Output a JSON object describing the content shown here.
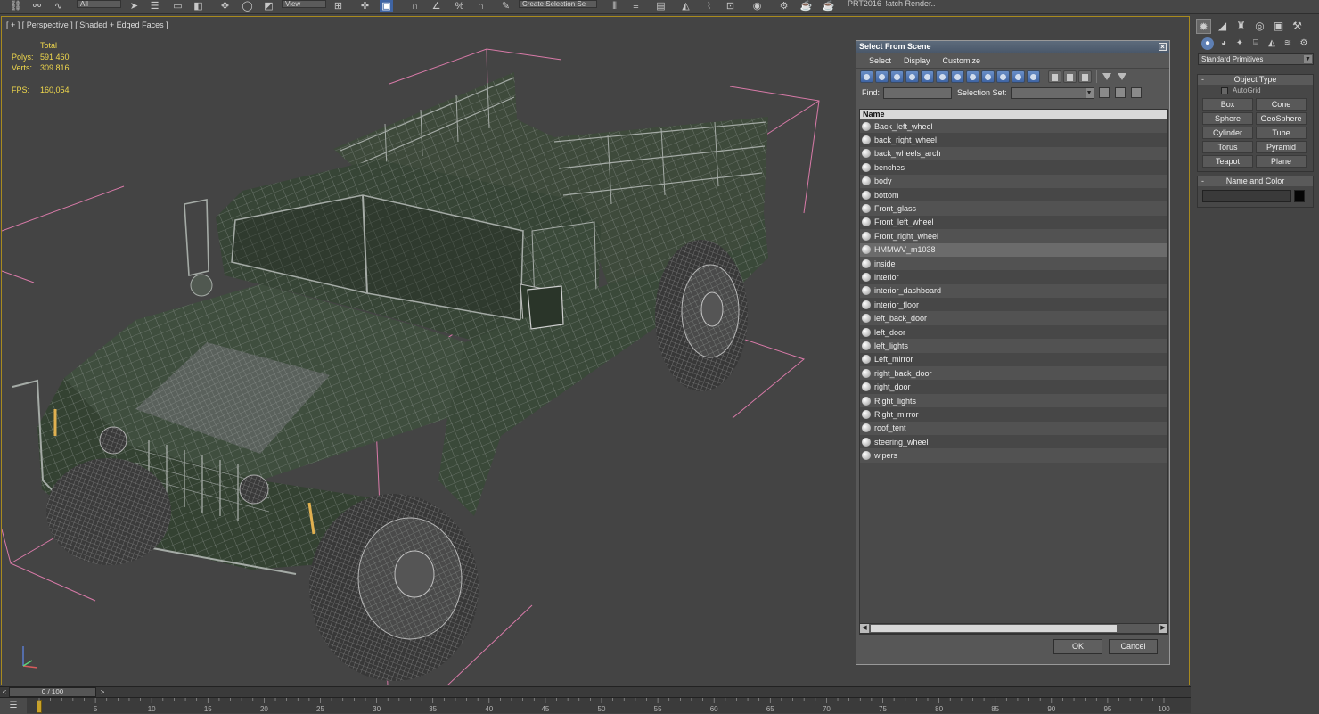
{
  "toolbar": {
    "selection_filter": "All",
    "reference_coord": "View",
    "named_selection": "Create Selection Se",
    "renderer_label": "PRT2016",
    "batch_render_label": "Batch Render.."
  },
  "viewport": {
    "label": "[ + ] [ Perspective ] [ Shaded + Edged Faces ]",
    "stats": {
      "total_label": "Total",
      "polys_label": "Polys:",
      "polys_value": "591 460",
      "verts_label": "Verts:",
      "verts_value": "309 816",
      "fps_label": "FPS:",
      "fps_value": "160,054"
    }
  },
  "dialog": {
    "title": "Select From Scene",
    "menu": [
      "Select",
      "Display",
      "Customize"
    ],
    "find_label": "Find:",
    "find_value": "",
    "selection_set_label": "Selection Set:",
    "selection_set_value": "",
    "column_header": "Name",
    "items": [
      {
        "name": "Back_left_wheel",
        "selected": false,
        "icon": "sphere-object-icon"
      },
      {
        "name": "back_right_wheel",
        "selected": false,
        "icon": "sphere-object-icon"
      },
      {
        "name": "back_wheels_arch",
        "selected": false,
        "icon": "sphere-object-icon"
      },
      {
        "name": "benches",
        "selected": false,
        "icon": "sphere-object-icon"
      },
      {
        "name": "body",
        "selected": false,
        "icon": "sphere-object-icon"
      },
      {
        "name": "bottom",
        "selected": false,
        "icon": "sphere-object-icon"
      },
      {
        "name": "Front_glass",
        "selected": false,
        "icon": "sphere-object-icon"
      },
      {
        "name": "Front_left_wheel",
        "selected": false,
        "icon": "sphere-object-icon"
      },
      {
        "name": "Front_right_wheel",
        "selected": false,
        "icon": "sphere-object-icon"
      },
      {
        "name": "HMMWV_m1038",
        "selected": true,
        "icon": "group-object-icon"
      },
      {
        "name": "inside",
        "selected": false,
        "icon": "sphere-object-icon"
      },
      {
        "name": "interior",
        "selected": false,
        "icon": "sphere-object-icon"
      },
      {
        "name": "interior_dashboard",
        "selected": false,
        "icon": "sphere-object-icon"
      },
      {
        "name": "interior_floor",
        "selected": false,
        "icon": "sphere-object-icon"
      },
      {
        "name": "left_back_door",
        "selected": false,
        "icon": "sphere-object-icon"
      },
      {
        "name": "left_door",
        "selected": false,
        "icon": "sphere-object-icon"
      },
      {
        "name": "left_lights",
        "selected": false,
        "icon": "sphere-object-icon"
      },
      {
        "name": "Left_mirror",
        "selected": false,
        "icon": "sphere-object-icon"
      },
      {
        "name": "right_back_door",
        "selected": false,
        "icon": "sphere-object-icon"
      },
      {
        "name": "right_door",
        "selected": false,
        "icon": "sphere-object-icon"
      },
      {
        "name": "Right_lights",
        "selected": false,
        "icon": "sphere-object-icon"
      },
      {
        "name": "Right_mirror",
        "selected": false,
        "icon": "sphere-object-icon"
      },
      {
        "name": "roof_tent",
        "selected": false,
        "icon": "sphere-object-icon"
      },
      {
        "name": "steering_wheel",
        "selected": false,
        "icon": "sphere-object-icon"
      },
      {
        "name": "wipers",
        "selected": false,
        "icon": "sphere-object-icon"
      }
    ],
    "ok_label": "OK",
    "cancel_label": "Cancel"
  },
  "command_panel": {
    "dropdown_value": "Standard Primitives",
    "object_type_header": "Object Type",
    "autogrid_label": "AutoGrid",
    "autogrid_checked": false,
    "primitives": [
      "Box",
      "Cone",
      "Sphere",
      "GeoSphere",
      "Cylinder",
      "Tube",
      "Torus",
      "Pyramid",
      "Teapot",
      "Plane"
    ],
    "name_color_header": "Name and Color",
    "object_name": "",
    "object_color": "#050505"
  },
  "time_slider": {
    "frame_label": "0 / 100",
    "ticks": [
      "5",
      "10",
      "15",
      "20",
      "25",
      "30",
      "35",
      "40",
      "45",
      "50",
      "55",
      "60",
      "65",
      "70",
      "75",
      "80",
      "85",
      "90",
      "95",
      "100"
    ]
  },
  "colors": {
    "viewport_border": "#a88a1e",
    "stats_text": "#f0d84c",
    "bbox_lines": "#d87aa8",
    "wire": "#8f9691",
    "hull": "#3f4e3e",
    "dialog_title": "#4f5d70"
  }
}
